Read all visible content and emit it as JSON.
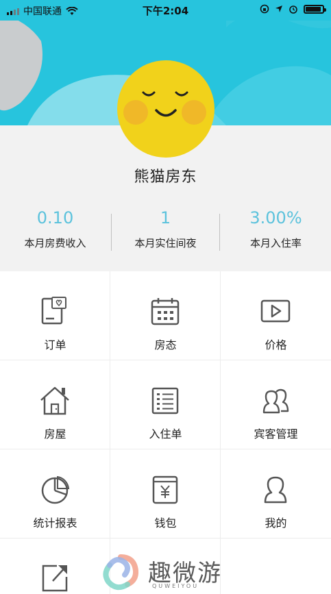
{
  "status_bar": {
    "carrier": "中国联通",
    "time": "下午2:04"
  },
  "profile": {
    "name": "熊猫房东"
  },
  "stats": [
    {
      "value": "0.10",
      "label": "本月房费收入"
    },
    {
      "value": "1",
      "label": "本月实住间夜"
    },
    {
      "value": "3.00%",
      "label": "本月入住率"
    }
  ],
  "menu": [
    {
      "label": "订单",
      "icon": "order-icon"
    },
    {
      "label": "房态",
      "icon": "calendar-icon"
    },
    {
      "label": "价格",
      "icon": "play-icon"
    },
    {
      "label": "房屋",
      "icon": "house-icon"
    },
    {
      "label": "入住单",
      "icon": "list-icon"
    },
    {
      "label": "宾客管理",
      "icon": "guests-icon"
    },
    {
      "label": "统计报表",
      "icon": "pie-chart-icon"
    },
    {
      "label": "钱包",
      "icon": "wallet-icon"
    },
    {
      "label": "我的",
      "icon": "user-icon"
    },
    {
      "label": "",
      "icon": "share-icon"
    }
  ],
  "watermark": {
    "text": "趣微游",
    "sub": "QUWEIYOU"
  },
  "colors": {
    "banner": "#27c4dd",
    "accent": "#5bc2dc",
    "avatar": "#f1d21b"
  }
}
